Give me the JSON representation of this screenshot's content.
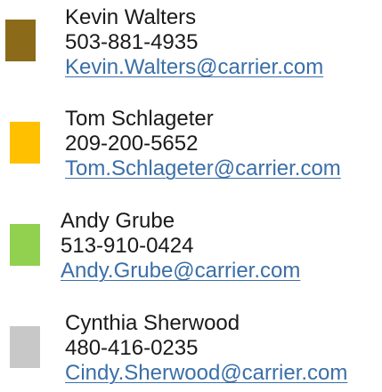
{
  "contacts": [
    {
      "name": "Kevin Walters",
      "phone": "503-881-4935",
      "email": "Kevin.Walters@carrier.com",
      "swatch_color": "#8b6a1a"
    },
    {
      "name": "Tom Schlageter",
      "phone": "209-200-5652",
      "email": "Tom.Schlageter@carrier.com",
      "swatch_color": "#ffc000"
    },
    {
      "name": "Andy Grube",
      "phone": "513-910-0424",
      "email": "Andy.Grube@carrier.com",
      "swatch_color": "#92d050"
    },
    {
      "name": "Cynthia Sherwood",
      "phone": "480-416-0235",
      "email": "Cindy.Sherwood@carrier.com",
      "swatch_color": "#c8c8c8"
    }
  ]
}
